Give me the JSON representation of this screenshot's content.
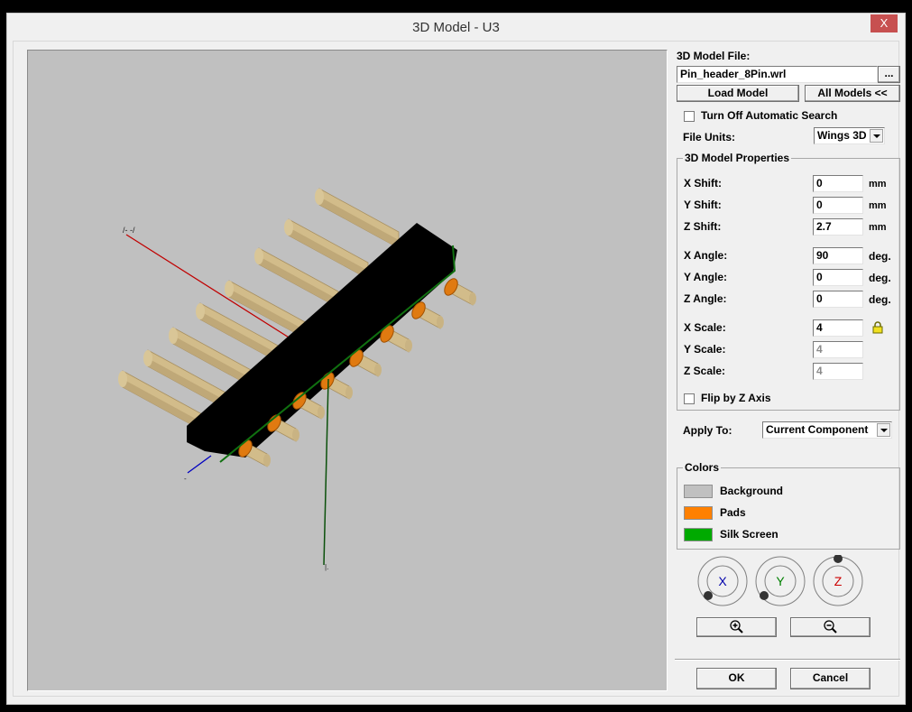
{
  "window": {
    "title": "3D Model - U3",
    "close_label": "X"
  },
  "model_file": {
    "label": "3D Model File:",
    "value": "Pin_header_8Pin.wrl",
    "browse_label": "...",
    "load_label": "Load Model",
    "all_models_label": "All Models <<"
  },
  "auto_search": {
    "label": "Turn Off Automatic Search",
    "checked": false
  },
  "file_units": {
    "label": "File Units:",
    "value": "Wings 3D"
  },
  "properties": {
    "title": "3D Model Properties",
    "x_shift": {
      "label": "X Shift:",
      "value": "0",
      "unit": "mm"
    },
    "y_shift": {
      "label": "Y Shift:",
      "value": "0",
      "unit": "mm"
    },
    "z_shift": {
      "label": "Z Shift:",
      "value": "2.7",
      "unit": "mm"
    },
    "x_angle": {
      "label": "X Angle:",
      "value": "90",
      "unit": "deg."
    },
    "y_angle": {
      "label": "Y Angle:",
      "value": "0",
      "unit": "deg."
    },
    "z_angle": {
      "label": "Z Angle:",
      "value": "0",
      "unit": "deg."
    },
    "x_scale": {
      "label": "X Scale:",
      "value": "4"
    },
    "y_scale": {
      "label": "Y Scale:",
      "value": "4"
    },
    "z_scale": {
      "label": "Z Scale:",
      "value": "4"
    },
    "flip_label": "Flip by Z Axis",
    "flip_checked": false
  },
  "apply_to": {
    "label": "Apply To:",
    "value": "Current Component"
  },
  "colors": {
    "title": "Colors",
    "items": [
      {
        "label": "Background",
        "color": "#c0c0c0"
      },
      {
        "label": "Pads",
        "color": "#ff8000"
      },
      {
        "label": "Silk Screen",
        "color": "#00aa00"
      }
    ]
  },
  "rotation_dials": [
    {
      "axis": "X",
      "color": "#0000aa"
    },
    {
      "axis": "Y",
      "color": "#008000"
    },
    {
      "axis": "Z",
      "color": "#cc0000"
    }
  ],
  "zoom": {
    "zoom_in": "zoom-in",
    "zoom_out": "zoom-out"
  },
  "footer": {
    "ok_label": "OK",
    "cancel_label": "Cancel"
  },
  "viewport": {
    "background": "#c0c0c0",
    "pin_count": 8,
    "pin_color": "#d2bc8a",
    "body_color": "#000000",
    "pad_color": "#e07a10",
    "silk_color": "#107010",
    "axis_x_color": "#c00000",
    "axis_y_color": "#0a500a",
    "axis_z_color": "#0000c0"
  }
}
